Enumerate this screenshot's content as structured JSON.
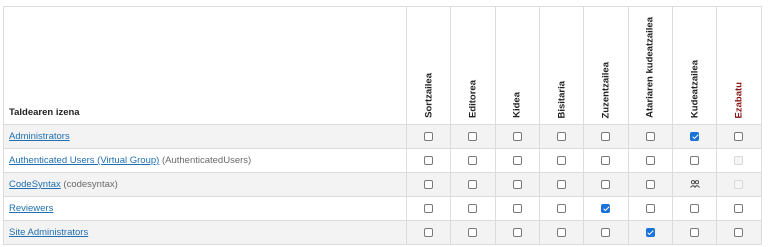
{
  "table": {
    "name_header": "Taldearen izena",
    "columns": [
      "Sortzailea",
      "Editorea",
      "Kidea",
      "Bisitaria",
      "Zuzentzailea",
      "Atariaren kudeatzailea",
      "Kudeatzailea",
      "Ezabatu"
    ],
    "rows": [
      {
        "name": "Administrators",
        "alias": "",
        "perms": [
          "unchecked",
          "unchecked",
          "unchecked",
          "unchecked",
          "unchecked",
          "unchecked",
          "checked",
          "unchecked"
        ]
      },
      {
        "name": "Authenticated Users (Virtual Group)",
        "alias": "(AuthenticatedUsers)",
        "perms": [
          "unchecked",
          "unchecked",
          "unchecked",
          "unchecked",
          "unchecked",
          "unchecked",
          "unchecked",
          "disabled"
        ]
      },
      {
        "name": "CodeSyntax",
        "alias": "(codesyntax)",
        "perms": [
          "unchecked",
          "unchecked",
          "unchecked",
          "unchecked",
          "unchecked",
          "unchecked",
          "group-icon",
          "disabled"
        ]
      },
      {
        "name": "Reviewers",
        "alias": "",
        "perms": [
          "unchecked",
          "unchecked",
          "unchecked",
          "unchecked",
          "checked",
          "unchecked",
          "unchecked",
          "unchecked"
        ]
      },
      {
        "name": "Site Administrators",
        "alias": "",
        "perms": [
          "unchecked",
          "unchecked",
          "unchecked",
          "unchecked",
          "unchecked",
          "checked",
          "unchecked",
          "unchecked"
        ]
      }
    ]
  },
  "colors": {
    "link": "#1f6fb2",
    "checked": "#1a73d9",
    "danger_header": "#8b1a1a",
    "row_alt": "#f3f3f3"
  }
}
